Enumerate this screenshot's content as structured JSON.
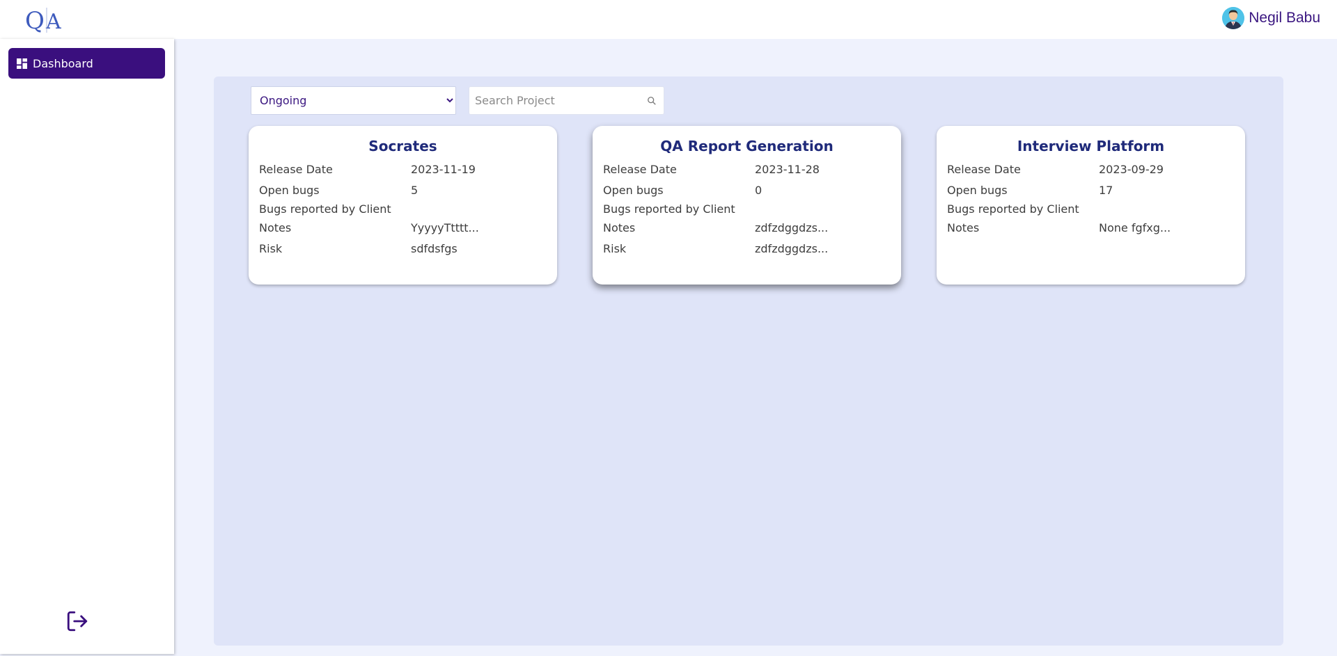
{
  "header": {
    "user_name": "Negil Babu"
  },
  "sidebar": {
    "items": [
      {
        "label": "Dashboard"
      }
    ]
  },
  "filters": {
    "status_selected": "Ongoing",
    "search_placeholder": "Search Project"
  },
  "projects": [
    {
      "title": "Socrates",
      "release_date_label": "Release Date",
      "release_date": "2023-11-19",
      "open_bugs_label": "Open bugs",
      "open_bugs": "5",
      "client_bugs_label": "Bugs reported by Client",
      "client_bugs": "",
      "notes_label": "Notes",
      "notes": "YyyyyTtttt...",
      "risk_label": "Risk",
      "risk": "sdfdsfgs"
    },
    {
      "title": "QA Report Generation",
      "release_date_label": "Release Date",
      "release_date": "2023-11-28",
      "open_bugs_label": "Open bugs",
      "open_bugs": "0",
      "client_bugs_label": "Bugs reported by Client",
      "client_bugs": "",
      "notes_label": "Notes",
      "notes": "zdfzdggdzs...",
      "risk_label": "Risk",
      "risk": "zdfzdggdzs..."
    },
    {
      "title": "Interview Platform",
      "release_date_label": "Release Date",
      "release_date": "2023-09-29",
      "open_bugs_label": "Open bugs",
      "open_bugs": "17",
      "client_bugs_label": "Bugs reported by Client",
      "client_bugs": "",
      "notes_label": "Notes",
      "notes": "None fgfxg..."
    }
  ],
  "icons": {
    "logo": "qa-logo-icon",
    "avatar": "user-avatar-icon",
    "dashboard": "dashboard-grid-icon",
    "search": "search-icon",
    "logout": "logout-icon"
  },
  "colors": {
    "accent": "#3a0f7e",
    "title": "#1f2a7a",
    "page_bg": "#eff2fd",
    "panel_bg": "#dfe4f8"
  }
}
